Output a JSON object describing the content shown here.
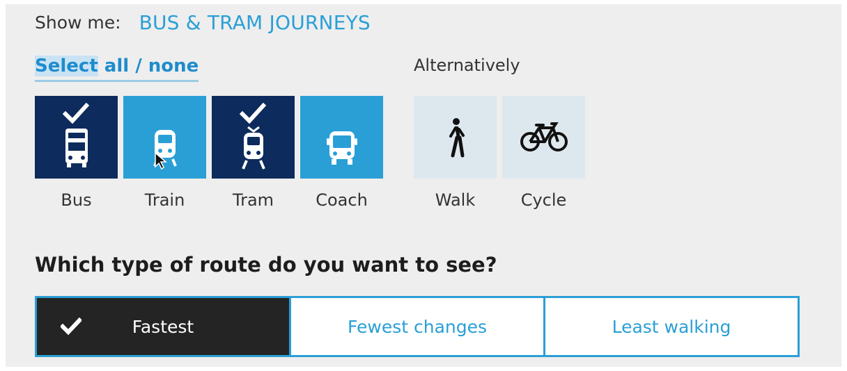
{
  "show_me": {
    "label": "Show me:",
    "value": "BUS & TRAM JOURNEYS"
  },
  "select": {
    "highlighted": "Select",
    "rest": " all / none"
  },
  "alternatively_label": "Alternatively",
  "modes": [
    {
      "label": "Bus",
      "selected": true,
      "icon": "bus-icon"
    },
    {
      "label": "Train",
      "selected": false,
      "icon": "train-icon"
    },
    {
      "label": "Tram",
      "selected": true,
      "icon": "tram-icon"
    },
    {
      "label": "Coach",
      "selected": false,
      "icon": "coach-icon"
    }
  ],
  "alternatives": [
    {
      "label": "Walk",
      "icon": "walk-icon"
    },
    {
      "label": "Cycle",
      "icon": "bicycle-icon"
    }
  ],
  "route_question": "Which type of route do you want to see?",
  "route_options": [
    {
      "label": "Fastest",
      "selected": true
    },
    {
      "label": "Fewest changes",
      "selected": false
    },
    {
      "label": "Least walking",
      "selected": false
    }
  ],
  "colors": {
    "selected_mode": "#0d2b5c",
    "unselected_mode": "#2a9fd6",
    "alternative_mode": "#dde8ee",
    "accent": "#2a9fd6",
    "active_route": "#242424"
  }
}
